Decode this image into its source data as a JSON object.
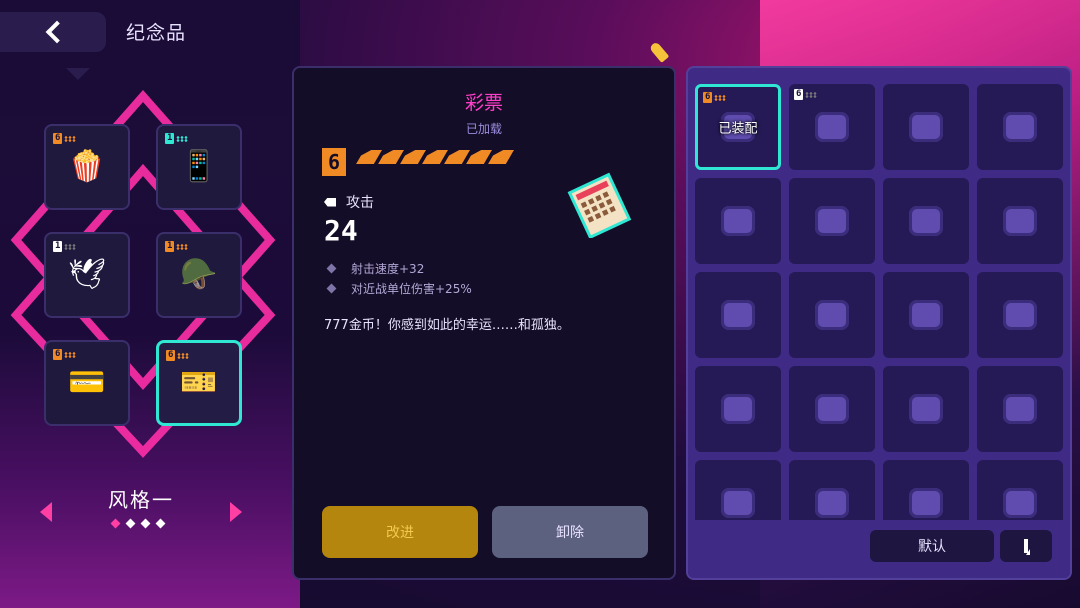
{
  "header": {
    "title": "纪念品"
  },
  "left": {
    "slots": [
      {
        "level": "6",
        "rarity": "orange",
        "icon": "popcorn-icon",
        "glyph": "🍿"
      },
      {
        "level": "1",
        "rarity": "teal",
        "icon": "phone-icon",
        "glyph": "📱"
      },
      {
        "level": "1",
        "rarity": "white",
        "icon": "dove-icon",
        "glyph": "🕊"
      },
      {
        "level": "1",
        "rarity": "orange",
        "icon": "helmet-icon",
        "glyph": "🪖"
      },
      {
        "level": "6",
        "rarity": "orange",
        "icon": "card-icon",
        "glyph": "💳"
      },
      {
        "level": "6",
        "rarity": "orange",
        "icon": "lottery-ticket-icon",
        "glyph": "🎫"
      }
    ],
    "style_label": "风格一",
    "pager_count": 4,
    "pager_active": 0
  },
  "detail": {
    "name": "彩票",
    "status": "已加载",
    "level": "6",
    "pip_count": 7,
    "attack_label": "攻击",
    "attack_value": "24",
    "stats": [
      "射击速度+32",
      "对近战单位伤害+25%"
    ],
    "description": "777金币！你感到如此的幸运……和孤独。",
    "upgrade_label": "改进",
    "remove_label": "卸除"
  },
  "inventory": {
    "cells": [
      {
        "icon": "lottery-ticket-icon",
        "level": "6",
        "label": "已装配",
        "selected": true
      },
      {
        "icon": "sneaker-icon",
        "level": "6",
        "label": "",
        "selected": false
      },
      {
        "icon": "cap-icon",
        "level": "",
        "label": "",
        "selected": false
      },
      {
        "icon": "stopwatch-icon",
        "level": "",
        "label": "",
        "selected": false
      },
      {
        "icon": "toast-icon",
        "level": "",
        "label": "",
        "selected": false
      },
      {
        "icon": "backpack-icon",
        "level": "",
        "label": "",
        "selected": false
      },
      {
        "icon": "cash-icon",
        "level": "",
        "label": "",
        "selected": false
      },
      {
        "icon": "portrait-icon",
        "level": "",
        "label": "",
        "selected": false
      },
      {
        "icon": "lucky-cat-icon",
        "level": "",
        "label": "",
        "selected": false
      },
      {
        "icon": "eye-badge-icon",
        "level": "",
        "label": "",
        "selected": false
      },
      {
        "icon": "feather-coin-icon",
        "level": "",
        "label": "",
        "selected": false
      },
      {
        "icon": "astronaut-icon",
        "level": "",
        "label": "",
        "selected": false
      },
      {
        "icon": "frog-icon",
        "level": "",
        "label": "",
        "selected": false
      },
      {
        "icon": "battery-icon",
        "level": "",
        "label": "",
        "selected": false
      },
      {
        "icon": "ghost-icon",
        "level": "",
        "label": "",
        "selected": false
      },
      {
        "icon": "crab-icon",
        "level": "",
        "label": "",
        "selected": false
      },
      {
        "icon": "frog-icon",
        "level": "",
        "label": "",
        "selected": false
      },
      {
        "icon": "scroll-icon",
        "level": "",
        "label": "",
        "selected": false
      },
      {
        "icon": "leaf-icon",
        "level": "",
        "label": "",
        "selected": false
      },
      {
        "icon": "robot-icon",
        "level": "",
        "label": "",
        "selected": false
      }
    ],
    "default_label": "默认"
  },
  "colors": {
    "accent_pink": "#ff3fa4",
    "accent_teal": "#2fe7d2",
    "level_orange": "#f08a24"
  }
}
